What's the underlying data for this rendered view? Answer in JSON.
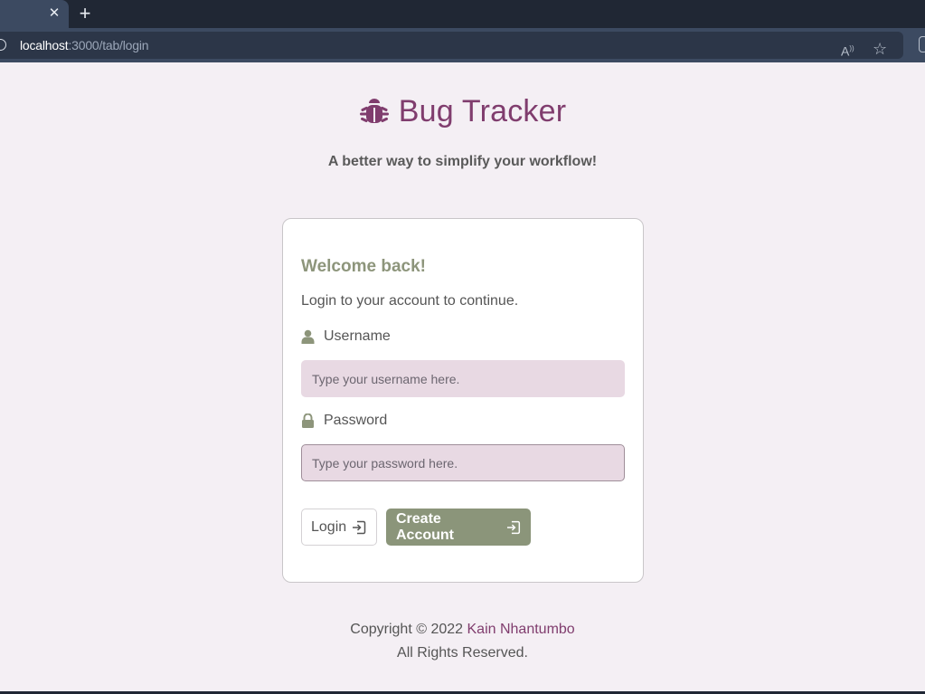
{
  "browser": {
    "tab_close_glyph": "✕",
    "new_tab_glyph": "+",
    "url_host": "localhost",
    "url_rest": ":3000/tab/login",
    "icons": [
      "site-info-icon",
      "read-aloud-icon",
      "favorites-icon",
      "extensions-icon"
    ]
  },
  "brand": {
    "title": "Bug Tracker",
    "icon": "bug-icon",
    "color": "#803d6e"
  },
  "tagline": "A better way to simplify your workflow!",
  "login_card": {
    "heading": "Welcome back!",
    "subtitle": "Login to your account to continue.",
    "username": {
      "label": "Username",
      "icon": "user-icon",
      "value": "",
      "placeholder": "Type your username here."
    },
    "password": {
      "label": "Password",
      "icon": "lock-icon",
      "value": "",
      "placeholder": "Type your password here."
    },
    "login_button": {
      "label": "Login",
      "icon": "sign-in-icon"
    },
    "create_button": {
      "label": "Create Account",
      "icon": "sign-in-icon",
      "color": "#8b957a"
    }
  },
  "footer": {
    "copyright": "Copyright © 2022",
    "author": "Kain Nhantumbo",
    "rights": "All Rights Reserved."
  },
  "colors": {
    "page_background": "#f4eff4",
    "accent": "#803d6e",
    "input_background": "#e8d9e3",
    "heading_green": "#8d957b"
  }
}
